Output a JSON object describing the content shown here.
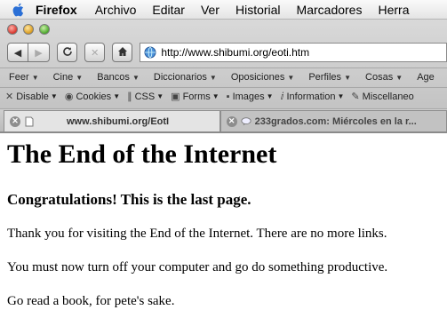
{
  "menubar": {
    "app": "Firefox",
    "items": [
      "Archivo",
      "Editar",
      "Ver",
      "Historial",
      "Marcadores",
      "Herra"
    ]
  },
  "toolbar": {
    "url": "http://www.shibumi.org/eoti.htm"
  },
  "bookmarks": [
    "Feer",
    "Cine",
    "Bancos",
    "Diccionarios",
    "Oposiciones",
    "Perfiles",
    "Cosas",
    "Age"
  ],
  "devbar": [
    "Disable",
    "Cookies",
    "CSS",
    "Forms",
    "Images",
    "Information",
    "Miscellaneo"
  ],
  "tabs": [
    {
      "label": "www.shibumi.org/EotI",
      "active": true
    },
    {
      "label": "233grados.com: Miércoles en la r...",
      "active": false
    }
  ],
  "page": {
    "heading": "The End of the Internet",
    "subheading": "Congratulations! This is the last page.",
    "paragraph1": "Thank you for visiting the End of the Internet. There are no more links.",
    "paragraph2": "You must now turn off your computer and go do something productive.",
    "paragraph3": "Go read a book, for pete's sake."
  }
}
